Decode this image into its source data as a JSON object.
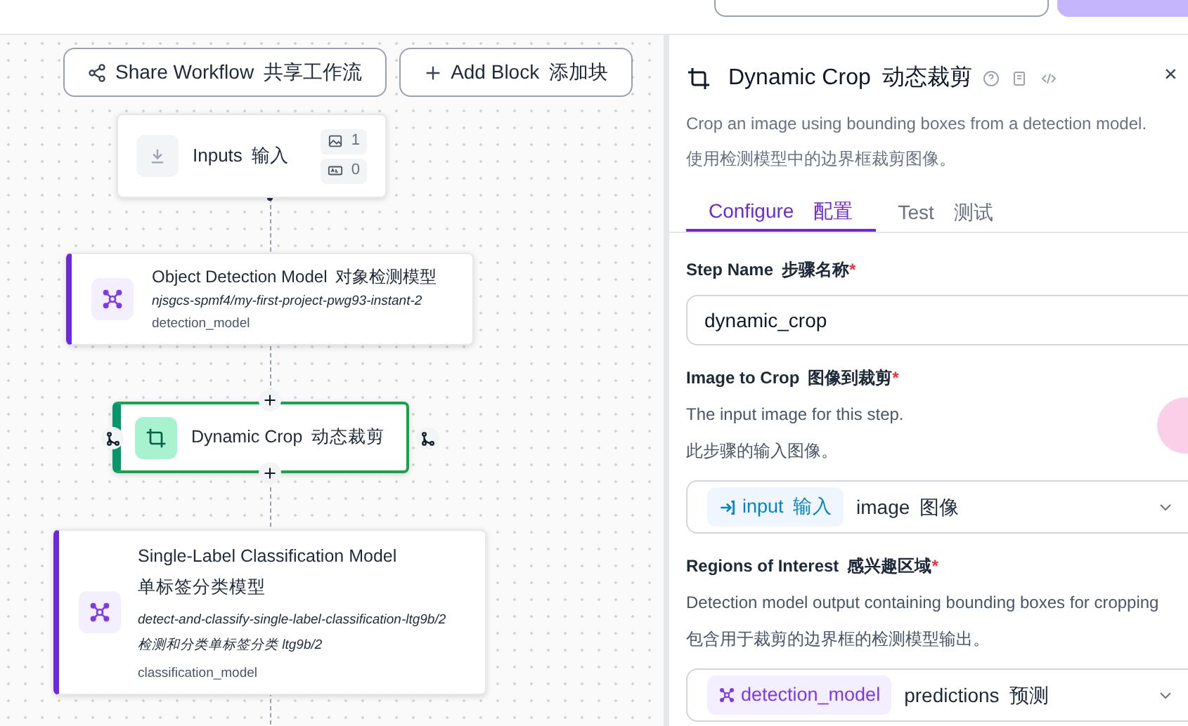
{
  "toolbar": {
    "buttons": [
      {
        "label": "Share Workflow",
        "label_zh": "共享工作流",
        "kind": "share"
      },
      {
        "label": "Add Block",
        "label_zh": "添加块",
        "kind": "add"
      }
    ]
  },
  "nodes": [
    {
      "kind": "inputs",
      "title": "Inputs",
      "title_zh": "输入",
      "selected": false,
      "counts": [
        {
          "kind": "image",
          "value": "1"
        },
        {
          "kind": "text",
          "value": "0"
        }
      ]
    },
    {
      "kind": "model",
      "title": "Object Detection Model",
      "title_zh": "对象检测模型",
      "selected": false,
      "model_id": "njsgcs-spmf4/my-first-project-pwg93-instant-2",
      "name": "detection_model"
    },
    {
      "kind": "crop",
      "title": "Dynamic Crop",
      "title_zh": "动态裁剪",
      "selected": true
    },
    {
      "kind": "model_wide",
      "title": "Single-Label Classification Model",
      "title_zh": "单标签分类模型",
      "selected": false,
      "model_id": "detect-and-classify-single-label-classification-ltg9b/2",
      "model_id_zh": "检测和分类单标签分类 ltg9b/2",
      "name": "classification_model"
    }
  ],
  "panel": {
    "title": "Dynamic Crop",
    "title_zh": "动态裁剪",
    "description": "Crop an image using bounding boxes from a detection model.",
    "description_zh": "使用检测模型中的边界框裁剪图像。",
    "tabs": [
      {
        "label": "Configure",
        "label_zh": "配置",
        "selected": true
      },
      {
        "label": "Test",
        "label_zh": "测试",
        "selected": false
      }
    ],
    "close": "×",
    "fields": [
      {
        "kind": "text",
        "label": "Step Name",
        "label_zh": "步骤名称",
        "required_mark": "*",
        "value": "dynamic_crop"
      },
      {
        "kind": "select",
        "label": "Image to Crop",
        "label_zh": "图像到裁剪",
        "required_mark": "*",
        "hint": "The input image for this step.",
        "hint_zh": "此步骤的输入图像。",
        "source": {
          "kind": "input",
          "label": "input",
          "label_zh": "输入"
        },
        "value": "image",
        "value_zh": "图像"
      },
      {
        "kind": "select",
        "label": "Regions of Interest",
        "label_zh": "感兴趣区域",
        "required_mark": "*",
        "hint": "Detection model output containing bounding boxes for cropping",
        "hint_zh": "包含用于裁剪的边界框的检测模型输出。",
        "source": {
          "kind": "model",
          "label": "detection_model"
        },
        "value": "predictions",
        "value_zh": "预测"
      }
    ]
  }
}
